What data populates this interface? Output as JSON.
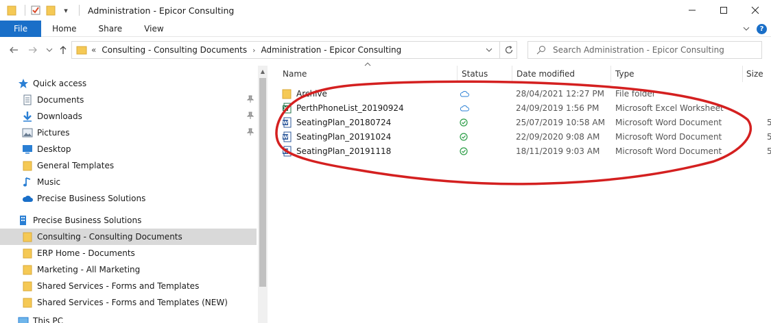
{
  "window": {
    "title": "Administration - Epicor Consulting",
    "quick_access_dropdown": "▾"
  },
  "ribbon": {
    "tabs": [
      {
        "label": "File"
      },
      {
        "label": "Home"
      },
      {
        "label": "Share"
      },
      {
        "label": "View"
      }
    ]
  },
  "address": {
    "overflow": "«",
    "crumbs": [
      "Consulting - Consulting Documents",
      "Administration - Epicor Consulting"
    ],
    "separator": "›"
  },
  "search": {
    "placeholder": "Search Administration - Epicor Consulting"
  },
  "nav": {
    "items": [
      {
        "label": "Quick access",
        "icon": "star-icon",
        "pinned": false
      },
      {
        "label": "Documents",
        "icon": "documents-icon",
        "pinned": true
      },
      {
        "label": "Downloads",
        "icon": "download-icon",
        "pinned": true
      },
      {
        "label": "Pictures",
        "icon": "pictures-icon",
        "pinned": true
      },
      {
        "label": "Desktop",
        "icon": "desktop-icon",
        "pinned": false
      },
      {
        "label": "General Templates",
        "icon": "folder-icon",
        "pinned": false
      },
      {
        "label": "Music",
        "icon": "music-icon",
        "pinned": false
      },
      {
        "label": "Precise Business Solutions",
        "icon": "cloud-icon",
        "pinned": false
      },
      {
        "label": "Precise Business Solutions",
        "icon": "building-icon",
        "pinned": false
      },
      {
        "label": "Consulting - Consulting Documents",
        "icon": "folder-icon",
        "pinned": false,
        "selected": true
      },
      {
        "label": "ERP Home - Documents",
        "icon": "folder-icon",
        "pinned": false
      },
      {
        "label": "Marketing - All Marketing",
        "icon": "folder-icon",
        "pinned": false
      },
      {
        "label": "Shared Services - Forms and Templates",
        "icon": "folder-icon",
        "pinned": false
      },
      {
        "label": "Shared Services - Forms and Templates (NEW)",
        "icon": "folder-icon",
        "pinned": false
      },
      {
        "label": "This PC",
        "icon": "pc-icon",
        "pinned": false
      }
    ]
  },
  "columns": {
    "name": "Name",
    "status": "Status",
    "date": "Date modified",
    "type": "Type",
    "size": "Size"
  },
  "files": [
    {
      "name": "Archive",
      "icon": "folder-icon",
      "status": "cloud",
      "date": "28/04/2021 12:27 PM",
      "type": "File folder",
      "size": ""
    },
    {
      "name": "PerthPhoneList_20190924",
      "icon": "excel-icon",
      "status": "cloud",
      "date": "24/09/2019 1:56 PM",
      "type": "Microsoft Excel Worksheet",
      "size": ""
    },
    {
      "name": "SeatingPlan_20180724",
      "icon": "word-icon",
      "status": "synced",
      "date": "25/07/2019 10:58 AM",
      "type": "Microsoft Word Document",
      "size": "5"
    },
    {
      "name": "SeatingPlan_20191024",
      "icon": "word-icon",
      "status": "synced",
      "date": "22/09/2020 9:08 AM",
      "type": "Microsoft Word Document",
      "size": "5"
    },
    {
      "name": "SeatingPlan_20191118",
      "icon": "word-icon",
      "status": "synced",
      "date": "18/11/2019 9:03 AM",
      "type": "Microsoft Word Document",
      "size": "5"
    }
  ],
  "colors": {
    "accent": "#1a6fc8",
    "folder": "#f5c955",
    "annotation": "#d42020",
    "synced": "#2a9d45",
    "cloud": "#2a7fd4"
  }
}
